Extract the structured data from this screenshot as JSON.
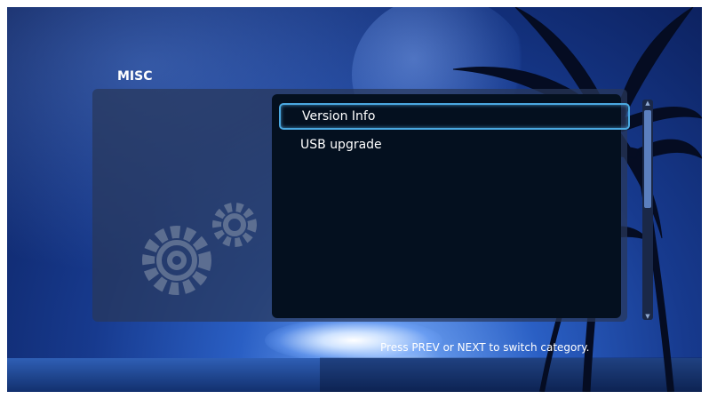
{
  "category": {
    "title": "MISC"
  },
  "menu": {
    "items": [
      {
        "label": "Version Info",
        "selected": true
      },
      {
        "label": "USB upgrade",
        "selected": false
      }
    ]
  },
  "footer": {
    "hint": "Press PREV or NEXT to switch category."
  },
  "colors": {
    "selection_border": "#4aa8e0",
    "list_bg": "#04101f",
    "panel_bg": "#28375a"
  },
  "icons": {
    "category_icon": "gears-icon"
  }
}
